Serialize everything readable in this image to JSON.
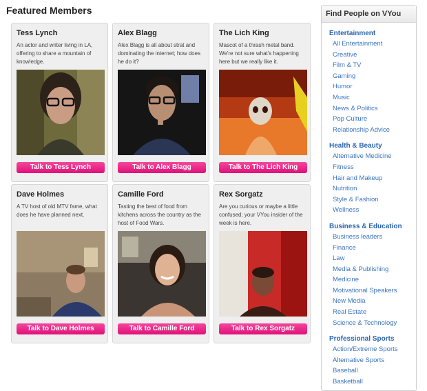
{
  "page": {
    "title": "Featured Members"
  },
  "members": [
    {
      "name": "Tess Lynch",
      "description": "An actor and writer living in LA, offering to share a mountain of knowledge.",
      "button": "Talk to Tess Lynch"
    },
    {
      "name": "Alex Blagg",
      "description": "Alex Blagg is all about strat and dominating the internet; how does he do it?",
      "button": "Talk to Alex Blagg"
    },
    {
      "name": "The Lich King",
      "description": "Mascot of a thrash metal band. We're not sure what's happening here but we really like it.",
      "button": "Talk to The Lich King"
    },
    {
      "name": "Dave Holmes",
      "description": "A TV host of old MTV fame, what does he have planned next.",
      "button": "Talk to Dave Holmes"
    },
    {
      "name": "Camille Ford",
      "description": "Tasting the best of food from kitchens across the country as the host of Food Wars.",
      "button": "Talk to Camille Ford"
    },
    {
      "name": "Rex Sorgatz",
      "description": "Are you curious or maybe a little confused; your VYou insider of the week is here.",
      "button": "Talk to Rex Sorgatz"
    }
  ],
  "sidebar": {
    "title": "Find People on VYou",
    "categories": [
      {
        "title": "Entertainment",
        "items": [
          "All Entertainment",
          "Creative",
          "Film & TV",
          "Gaming",
          "Humor",
          "Music",
          "News & Politics",
          "Pop Culture",
          "Relationship Advice"
        ]
      },
      {
        "title": "Health & Beauty",
        "items": [
          "Alternative Medicine",
          "Fitness",
          "Hair and Makeup",
          "Nutrition",
          "Style & Fashion",
          "Wellness"
        ]
      },
      {
        "title": "Business & Education",
        "items": [
          "Business leaders",
          "Finance",
          "Law",
          "Media & Publishing",
          "Medicine",
          "Motivational Speakers",
          "New Media",
          "Real Estate",
          "Science & Technology"
        ]
      },
      {
        "title": "Professional Sports",
        "items": [
          "Action/Extreme Sports",
          "Alternative Sports",
          "Baseball",
          "Basketball"
        ]
      }
    ]
  },
  "colors": {
    "button": "#e8167f",
    "link": "#3a74bf",
    "category": "#2a64b0"
  }
}
